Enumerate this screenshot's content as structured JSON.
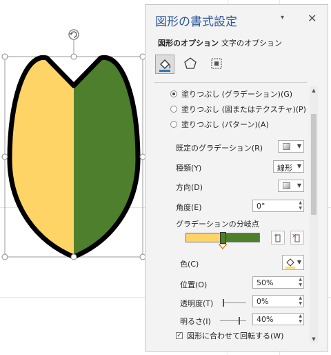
{
  "pane": {
    "title": "図形の書式設定",
    "menu_glyph": "▾",
    "close_glyph": "✕",
    "tabs": [
      "図形のオプション",
      "文字のオプション"
    ],
    "icon_tabs": [
      "fill-line-icon",
      "effects-pentagon-icon",
      "size-properties-icon"
    ]
  },
  "fill_options": [
    {
      "label": "塗りつぶし (グラデーション)(G)",
      "selected": true
    },
    {
      "label": "塗りつぶし (図またはテクスチャ)(P)",
      "selected": false
    },
    {
      "label": "塗りつぶし (パターン)(A)",
      "selected": false
    }
  ],
  "fields": {
    "preset_label": "既定のグラデーション(R)",
    "type_label": "種類(Y)",
    "type_value": "線形",
    "direction_label": "方向(D)",
    "angle_label": "角度(E)",
    "angle_value": "0°",
    "stops_label": "グラデーションの分岐点",
    "color_label": "色(C)",
    "position_label": "位置(O)",
    "position_value": "50%",
    "transparency_label": "透明度(T)",
    "transparency_value": "0%",
    "brightness_label": "明るさ(I)",
    "brightness_value": "40%",
    "rotate_label": "図形に合わせて回転する(W)",
    "rotate_checked": true
  },
  "gradient": {
    "color_left": "#ffd466",
    "color_right": "#4e7f2c",
    "stop_position": 0.5,
    "transparency_level": 0,
    "brightness_level": 0.4
  },
  "shape": {
    "fill_left": "#ffd466",
    "fill_right": "#4e7f2c",
    "outline": "#000000"
  },
  "icons": {
    "rotate_handle": "rotate-handle-icon",
    "add_stop": "add-gradient-stop-icon",
    "remove_stop": "remove-gradient-stop-icon",
    "paint_bucket": "paint-bucket-icon"
  }
}
